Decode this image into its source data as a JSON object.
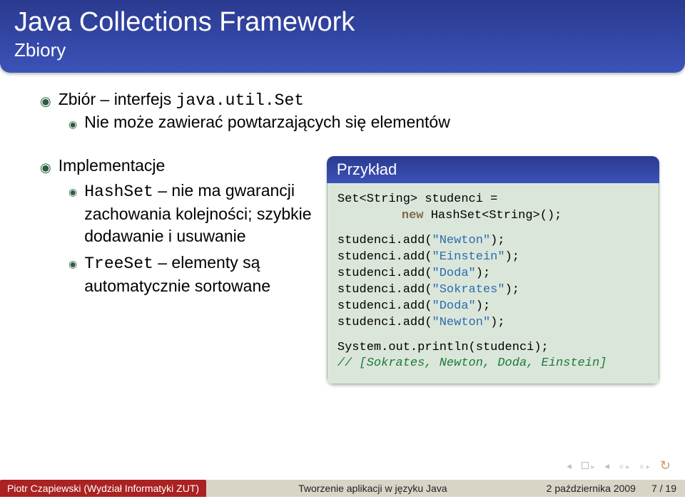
{
  "header": {
    "title": "Java Collections Framework",
    "subtitle": "Zbiory"
  },
  "intro": {
    "line1_pre": "Zbiór – interfejs ",
    "line1_code": "java.util.Set",
    "sub1": "Nie może zawierać powtarzających się elementów"
  },
  "impl": {
    "heading": "Implementacje",
    "items": [
      {
        "code": "HashSet",
        "text": " – nie ma gwarancji zachowania kolejności; szybkie dodawanie i usuwanie"
      },
      {
        "code": "TreeSet",
        "text": " – elementy są automatycznie sortowane"
      }
    ]
  },
  "example": {
    "title": "Przykład",
    "l1a": "Set<String> studenci =",
    "l1b_new": "new",
    "l1b_rest": " HashSet<String>();",
    "adds": [
      {
        "pre": "studenci.add(",
        "str": "\"Newton\"",
        "post": ");"
      },
      {
        "pre": "studenci.add(",
        "str": "\"Einstein\"",
        "post": ");"
      },
      {
        "pre": "studenci.add(",
        "str": "\"Doda\"",
        "post": ");"
      },
      {
        "pre": "studenci.add(",
        "str": "\"Sokrates\"",
        "post": ");"
      },
      {
        "pre": "studenci.add(",
        "str": "\"Doda\"",
        "post": ");"
      },
      {
        "pre": "studenci.add(",
        "str": "\"Newton\"",
        "post": ");"
      }
    ],
    "print": "System.out.println(studenci);",
    "comment": "// [Sokrates, Newton, Doda, Einstein]"
  },
  "footer": {
    "author": "Piotr Czapiewski (Wydział Informatyki ZUT)",
    "center": "Tworzenie aplikacji w języku Java",
    "date": "2 października 2009",
    "page": "7 / 19"
  }
}
